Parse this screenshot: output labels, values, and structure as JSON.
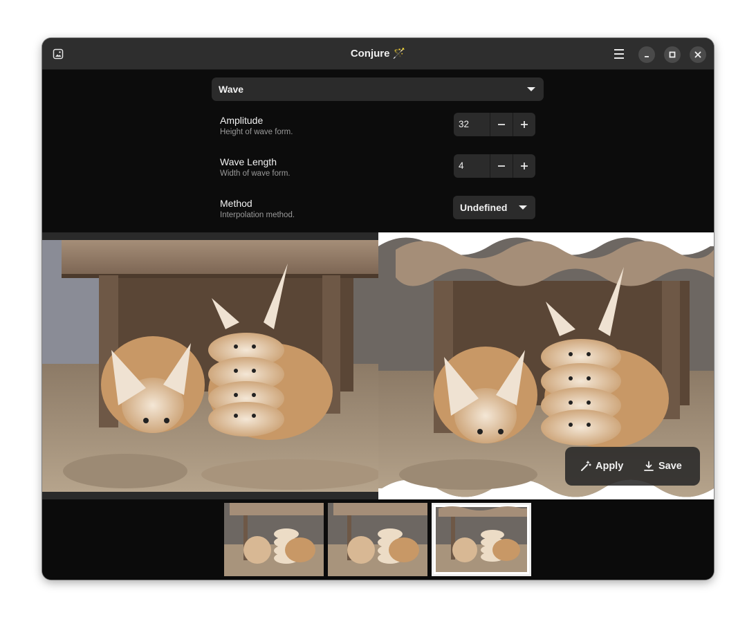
{
  "window": {
    "title": "Conjure",
    "title_emoji": "🪄",
    "controls": [
      "menu-icon",
      "minimize-icon",
      "maximize-icon",
      "close-icon"
    ]
  },
  "effect": {
    "selected": "Wave"
  },
  "parameters": {
    "amplitude": {
      "title": "Amplitude",
      "subtitle": "Height of wave form.",
      "value": "32"
    },
    "wave_length": {
      "title": "Wave Length",
      "subtitle": "Width of wave form.",
      "value": "4"
    },
    "method": {
      "title": "Method",
      "subtitle": "Interpolation method.",
      "value": "Undefined"
    }
  },
  "actions": {
    "apply_label": "Apply",
    "save_label": "Save"
  },
  "thumbnails": {
    "count": 3,
    "selected_index": 2
  },
  "colors": {
    "window_bg": "#0c0c0c",
    "headerbar_bg": "#2e2e2e",
    "control_bg": "#2b2b2b",
    "subtitle": "#9a9a9a",
    "wand": "#e8c36a"
  }
}
